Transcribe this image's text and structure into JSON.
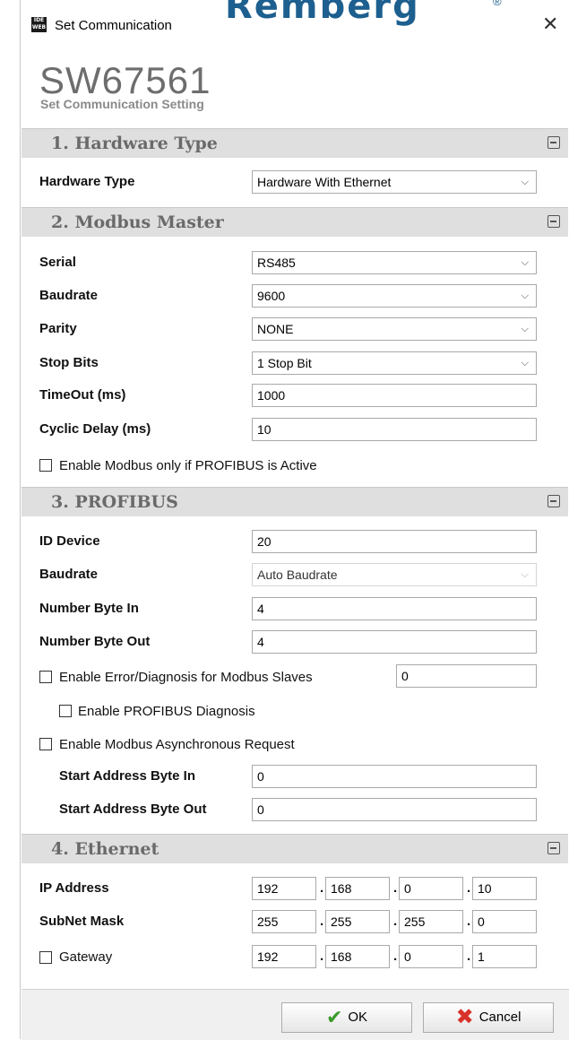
{
  "window": {
    "title": "Set Communication",
    "brand": "Rember",
    "brand_end": "g",
    "brand_reg": "®",
    "close": "✕",
    "app_icon": "IDE WEB"
  },
  "product": {
    "name": "SW67561",
    "subtitle": "Set Communication Setting"
  },
  "sections": {
    "hardware": {
      "title": "1. Hardware Type",
      "type_label": "Hardware Type",
      "type_value": "Hardware With Ethernet"
    },
    "modbus": {
      "title": "2. Modbus Master",
      "serial_label": "Serial",
      "serial_value": "RS485",
      "baud_label": "Baudrate",
      "baud_value": "9600",
      "parity_label": "Parity",
      "parity_value": "NONE",
      "stop_label": "Stop Bits",
      "stop_value": "1 Stop Bit",
      "timeout_label": "TimeOut (ms)",
      "timeout_value": "1000",
      "delay_label": "Cyclic Delay (ms)",
      "delay_value": "10",
      "enable_label": "Enable Modbus only if PROFIBUS is Active",
      "enable_checked": false
    },
    "profibus": {
      "title": "3. PROFIBUS",
      "id_label": "ID Device",
      "id_value": "20",
      "baud_label": "Baudrate",
      "baud_value": "Auto Baudrate",
      "bytein_label": "Number Byte In",
      "bytein_value": "4",
      "byteout_label": "Number Byte Out",
      "byteout_value": "4",
      "err_label": "Enable Error/Diagnosis for Modbus Slaves",
      "err_value": "0",
      "err_checked": false,
      "diag_label": "Enable PROFIBUS Diagnosis",
      "diag_checked": false,
      "async_label": "Enable Modbus Asynchronous Request",
      "async_checked": false,
      "startin_label": "Start Address Byte In",
      "startin_value": "0",
      "startout_label": "Start Address Byte Out",
      "startout_value": "0"
    },
    "ethernet": {
      "title": "4. Ethernet",
      "ip_label": "IP Address",
      "ip": [
        "192",
        "168",
        "0",
        "10"
      ],
      "mask_label": "SubNet Mask",
      "mask": [
        "255",
        "255",
        "255",
        "0"
      ],
      "gw_label": "Gateway",
      "gw": [
        "192",
        "168",
        "0",
        "1"
      ],
      "gw_checked": false,
      "dot": "."
    }
  },
  "icons": {
    "collapse": "collapse-icon",
    "dropdown": "⌵"
  },
  "footer": {
    "ok_label": "OK",
    "cancel_label": "Cancel",
    "ok_icon": "✔",
    "cancel_icon": "✖"
  },
  "colors": {
    "brand": "#1d5f8f",
    "section_bg": "#dfdfdf",
    "ok_green": "#3a9b2a",
    "cancel_red": "#d8312a"
  }
}
